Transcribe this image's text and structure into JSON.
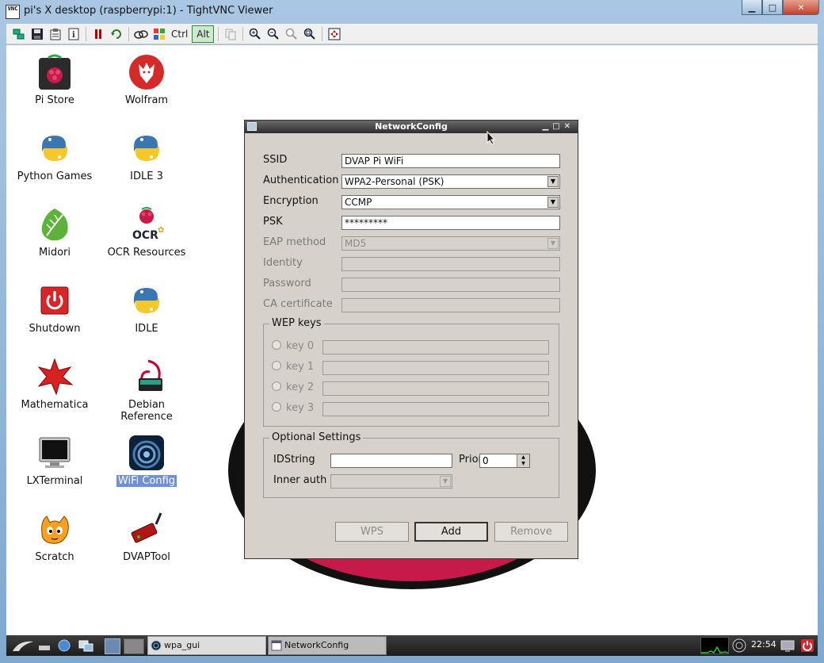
{
  "window": {
    "title": "pi's X desktop (raspberrypi:1) - TightVNC Viewer",
    "app_icon_text": "VNC"
  },
  "toolbar": {
    "ctrl_label": "Ctrl",
    "alt_label": "Alt"
  },
  "desktop_icons": [
    {
      "label": "Pi Store",
      "icon": "pi-store-icon"
    },
    {
      "label": "Wolfram",
      "icon": "wolfram-icon"
    },
    {
      "label": "Python Games",
      "icon": "python-games-icon"
    },
    {
      "label": "IDLE 3",
      "icon": "idle3-icon"
    },
    {
      "label": "Midori",
      "icon": "midori-icon"
    },
    {
      "label": "OCR Resources",
      "icon": "ocr-resources-icon"
    },
    {
      "label": "Shutdown",
      "icon": "shutdown-icon"
    },
    {
      "label": "IDLE",
      "icon": "idle-icon"
    },
    {
      "label": "Mathematica",
      "icon": "mathematica-icon"
    },
    {
      "label": "Debian Reference",
      "icon": "debian-reference-icon"
    },
    {
      "label": "LXTerminal",
      "icon": "lxterminal-icon"
    },
    {
      "label": "WiFi Config",
      "icon": "wifi-config-icon"
    },
    {
      "label": "Scratch",
      "icon": "scratch-icon"
    },
    {
      "label": "DVAPTool",
      "icon": "dvaptool-icon"
    }
  ],
  "dialog": {
    "title": "NetworkConfig",
    "ssid_label": "SSID",
    "ssid_value": "DVAP Pi WiFi",
    "auth_label": "Authentication",
    "auth_value": "WPA2-Personal (PSK)",
    "encryption_label": "Encryption",
    "encryption_value": "CCMP",
    "psk_label": "PSK",
    "psk_value": "*********",
    "eap_label": "EAP method",
    "eap_value": "MD5",
    "identity_label": "Identity",
    "password_label": "Password",
    "ca_label": "CA certificate",
    "wep_group_title": "WEP keys",
    "wep_keys": [
      "key 0",
      "key 1",
      "key 2",
      "key 3"
    ],
    "optional_group_title": "Optional Settings",
    "idstring_label": "IDString",
    "idstring_value": "",
    "priority_label": "Priority",
    "priority_value": "0",
    "inner_auth_label": "Inner auth",
    "inner_auth_value": "",
    "wps_label": "WPS",
    "add_label": "Add",
    "remove_label": "Remove"
  },
  "taskbar": {
    "tasks": [
      {
        "label": "wpa_gui",
        "icon": "wifi-icon"
      },
      {
        "label": "NetworkConfig",
        "icon": "window-icon"
      }
    ],
    "clock": "22:54"
  }
}
